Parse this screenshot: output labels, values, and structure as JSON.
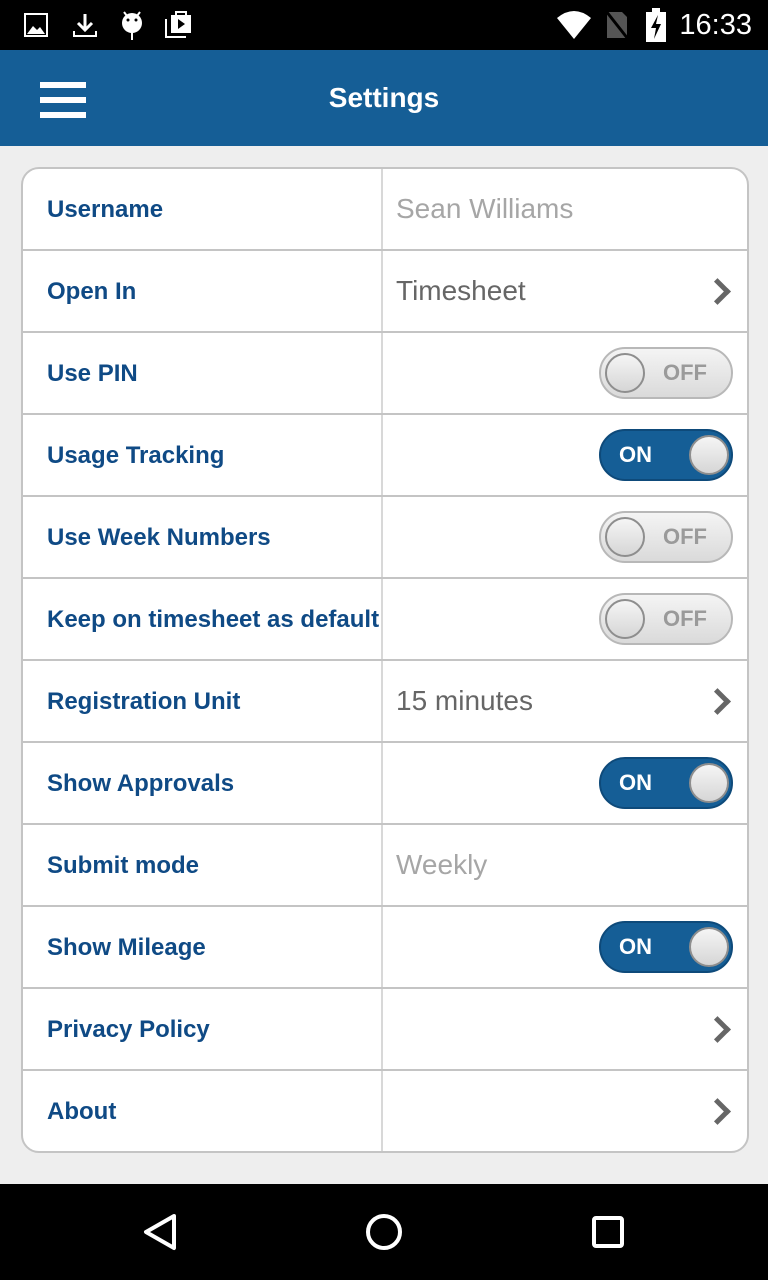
{
  "status_bar": {
    "left_icons": [
      "image-icon",
      "download-icon",
      "android-debug-icon",
      "play-store-icon"
    ],
    "right_icons": [
      "wifi-icon",
      "no-sim-icon",
      "battery-charging-icon"
    ],
    "time": "16:33"
  },
  "app_bar": {
    "menu_icon": "hamburger-menu-icon",
    "title": "Settings"
  },
  "settings": [
    {
      "label": "Username",
      "type": "text",
      "value": "Sean Williams",
      "muted": true
    },
    {
      "label": "Open In",
      "type": "select",
      "value": "Timesheet"
    },
    {
      "label": "Use PIN",
      "type": "toggle",
      "on": false,
      "toggle_text": "OFF"
    },
    {
      "label": "Usage Tracking",
      "type": "toggle",
      "on": true,
      "toggle_text": "ON"
    },
    {
      "label": "Use Week Numbers",
      "type": "toggle",
      "on": false,
      "toggle_text": "OFF"
    },
    {
      "label": "Keep on timesheet as default",
      "type": "toggle",
      "on": false,
      "toggle_text": "OFF"
    },
    {
      "label": "Registration Unit",
      "type": "select",
      "value": "15 minutes"
    },
    {
      "label": "Show Approvals",
      "type": "toggle",
      "on": true,
      "toggle_text": "ON"
    },
    {
      "label": "Submit mode",
      "type": "text",
      "value": "Weekly",
      "muted": true
    },
    {
      "label": "Show Mileage",
      "type": "toggle",
      "on": true,
      "toggle_text": "ON"
    },
    {
      "label": "Privacy Policy",
      "type": "link",
      "value": ""
    },
    {
      "label": "About",
      "type": "link",
      "value": ""
    }
  ],
  "colors": {
    "primary": "#155e96",
    "label_text": "#0f4a85",
    "muted_text": "#a6a6a6",
    "background": "#eeeeee"
  },
  "nav_bar": {
    "buttons": [
      "back-icon",
      "home-icon",
      "recents-icon"
    ]
  }
}
